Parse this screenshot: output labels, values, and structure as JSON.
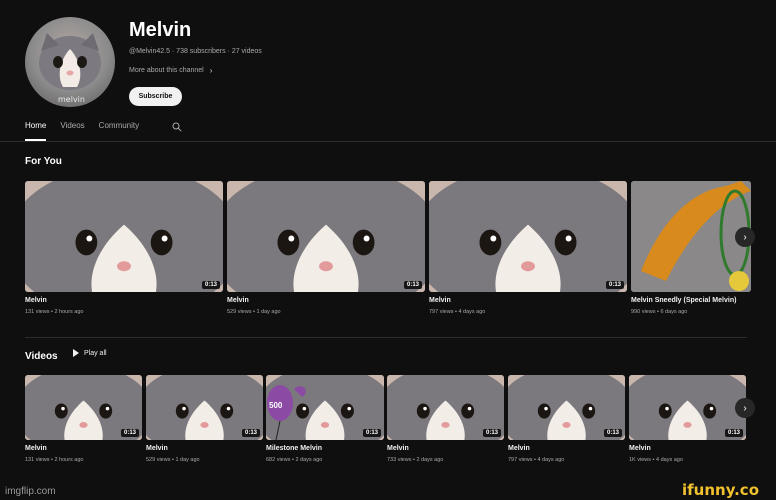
{
  "channel": {
    "name": "Melvin",
    "meta": "@Melvin42.5 · 738 subscribers · 27 videos",
    "more_label": "More about this channel",
    "subscribe_label": "Subscribe",
    "avatar_caption": "melvin"
  },
  "tabs": [
    {
      "label": "Home",
      "active": true
    },
    {
      "label": "Videos",
      "active": false
    },
    {
      "label": "Community",
      "active": false
    }
  ],
  "for_you": {
    "title": "For You",
    "videos": [
      {
        "title": "Melvin",
        "meta": "131 views • 2 hours ago",
        "duration": "0:13",
        "art": "cat"
      },
      {
        "title": "Melvin",
        "meta": "529 views • 1 day ago",
        "duration": "0:13",
        "art": "cat"
      },
      {
        "title": "Melvin",
        "meta": "797 views • 4 days ago",
        "duration": "0:13",
        "art": "cat"
      },
      {
        "title": "Melvin Sneedly (Special Melvin)",
        "meta": "990 views • 6 days ago",
        "duration": "",
        "art": "sneedly"
      }
    ]
  },
  "videos_section": {
    "title": "Videos",
    "play_all_label": "Play all",
    "videos": [
      {
        "title": "Melvin",
        "meta": "131 views • 2 hours ago",
        "duration": "0:13",
        "art": "cat"
      },
      {
        "title": "Melvin",
        "meta": "529 views • 1 day ago",
        "duration": "0:13",
        "art": "cat"
      },
      {
        "title": "Milestone Melvin",
        "meta": "682 views • 2 days ago",
        "duration": "0:13",
        "art": "milestone",
        "balloon_text": "500"
      },
      {
        "title": "Melvin",
        "meta": "733 views • 2 days ago",
        "duration": "0:13",
        "art": "cat"
      },
      {
        "title": "Melvin",
        "meta": "797 views • 4 days ago",
        "duration": "0:13",
        "art": "cat"
      },
      {
        "title": "Melvin",
        "meta": "1K views • 4 days ago",
        "duration": "0:13",
        "art": "cat"
      }
    ]
  },
  "watermarks": {
    "left": "imgflip.com",
    "right": "ifunny.co"
  },
  "colors": {
    "background": "#0f0f0f",
    "text": "#f1f1f1",
    "secondary_text": "#aaaaaa",
    "watermark_yellow": "#f2c12e",
    "balloon_purple": "#8b4aa3"
  }
}
